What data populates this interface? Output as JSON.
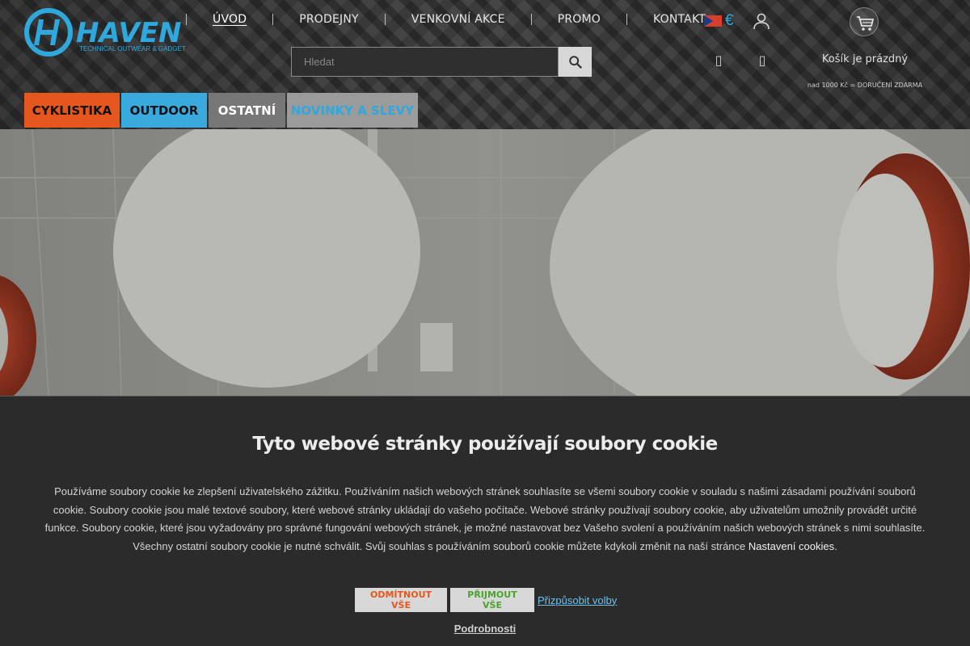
{
  "brand": {
    "name": "HAVEN",
    "tagline": "TECHNICAL OUTWEAR & GADGETS",
    "accent_color": "#2ea8dd"
  },
  "nav": {
    "items": [
      {
        "label": "ÚVOD"
      },
      {
        "label": "PRODEJNY"
      },
      {
        "label": "VENKOVNÍ AKCE"
      },
      {
        "label": "PROMO"
      },
      {
        "label": "KONTAKT"
      }
    ]
  },
  "header": {
    "currency_symbol": "€",
    "currency_flag_icon": "czech-flag-icon",
    "user_icon": "user-icon",
    "cart_icon": "shopping-cart-icon",
    "cart_status": "Košík je prázdný",
    "free_delivery": "nad 1000 Kč = DORUČENÍ ZDARMA"
  },
  "search": {
    "placeholder": "Hledat",
    "button_icon": "search-icon"
  },
  "categories": [
    {
      "label": "CYKLISTIKA",
      "color": "#e5571c"
    },
    {
      "label": "OUTDOOR",
      "color": "#3aa9de"
    },
    {
      "label": "OSTATNÍ",
      "color": "#777777"
    },
    {
      "label": "NOVINKY A SLEVY",
      "color": "#9b9b9b"
    }
  ],
  "cookie": {
    "title": "Tyto webové stránky používají soubory cookie",
    "text": "Používáme soubory cookie ke zlepšení uživatelského zážitku. Používáním našich webových stránek souhlasíte se všemi soubory cookie v souladu s našimi zásadami používání souborů cookie. Soubory cookie jsou malé textové soubory, které webové stránky ukládají do vašeho počítače. Webové stránky používají soubory cookie, aby uživatelům umožnily provádět určité funkce. Soubory cookie, které jsou vyžadovány pro správné fungování webových stránek, je možné nastavovat bez Vašeho svolení a používáním našich webových stránek s nimi souhlasíte. Všechny ostatní soubory cookie je nutné schválit. Svůj souhlas s používáním souborů cookie můžete kdykoli změnit na naší stránce",
    "settings_link": "Nastavení cookies",
    "period": ".",
    "reject_label": "ODMÍTNOUT VŠE",
    "accept_label": "PŘIJMOUT VŠE",
    "customize_label": "Přizpůsobit volby",
    "details_label": "Podrobnosti"
  }
}
